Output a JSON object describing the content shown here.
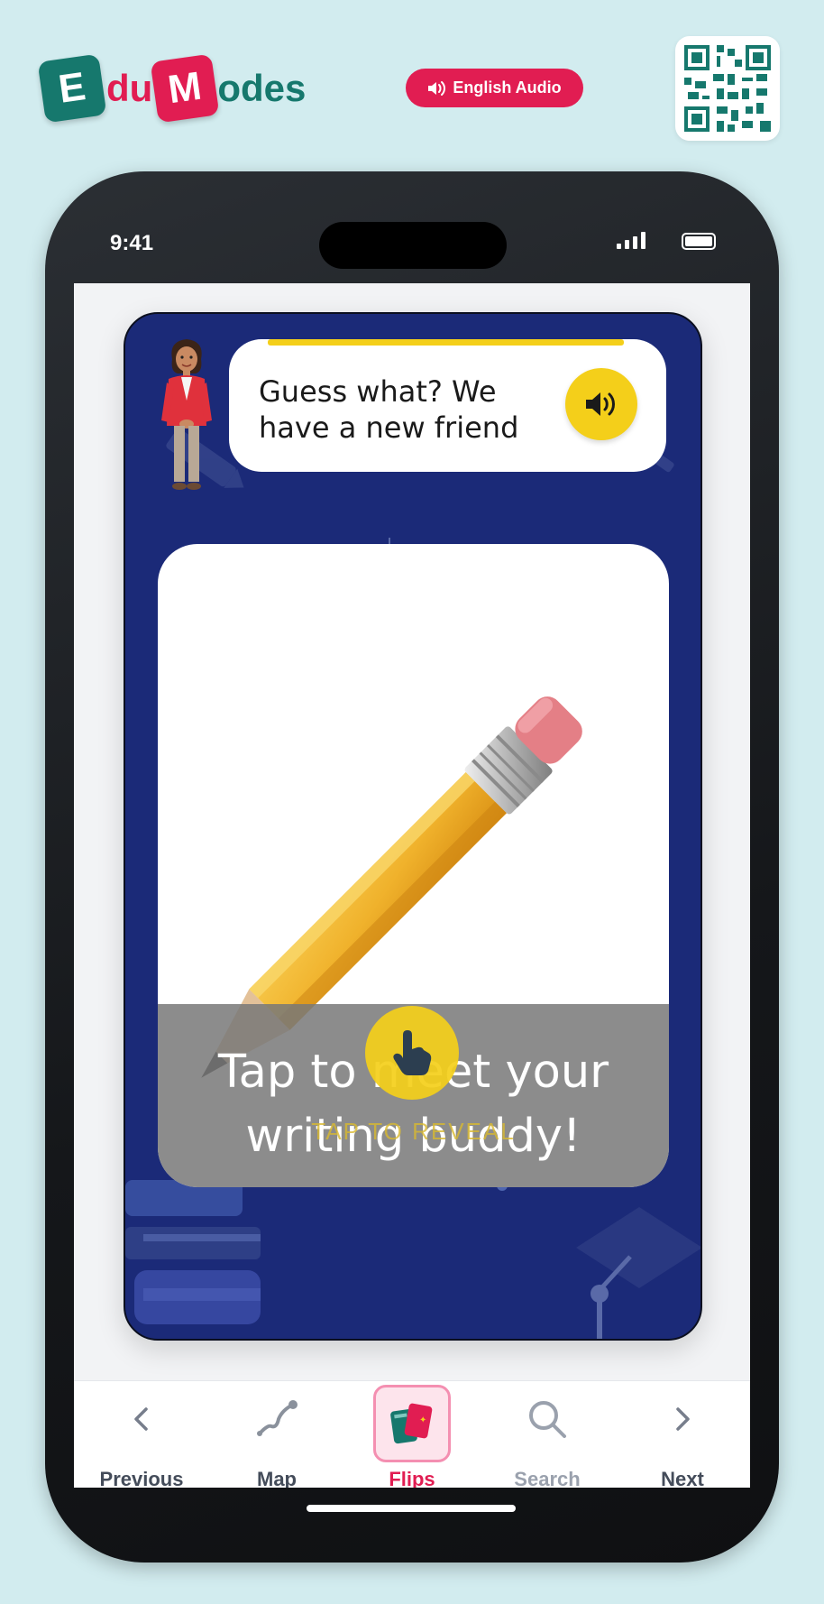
{
  "brand": {
    "e_letter": "E",
    "du": "du",
    "m_letter": "M",
    "odes": "odes"
  },
  "header": {
    "audio_label": "English Audio",
    "qr_icon": "qr-code-icon"
  },
  "status_bar": {
    "time": "9:41"
  },
  "card": {
    "speech_text": "Guess what? We have a new friend t...",
    "reveal_caption": "Tap to meet your writing buddy!",
    "tap_to_reveal": "TAP TO REVEAL",
    "image_subject": "pencil"
  },
  "nav": {
    "items": [
      {
        "label": "Previous",
        "icon": "chevron-left-icon"
      },
      {
        "label": "Map",
        "icon": "map-route-icon"
      },
      {
        "label": "Flips",
        "icon": "flip-cards-icon",
        "active": true
      },
      {
        "label": "Search",
        "icon": "search-icon"
      },
      {
        "label": "Next",
        "icon": "chevron-right-icon"
      }
    ]
  },
  "colors": {
    "brand_teal": "#16786d",
    "brand_pink": "#e11d52",
    "card_blue": "#1b2a78",
    "accent_yellow": "#f4cf1a"
  }
}
